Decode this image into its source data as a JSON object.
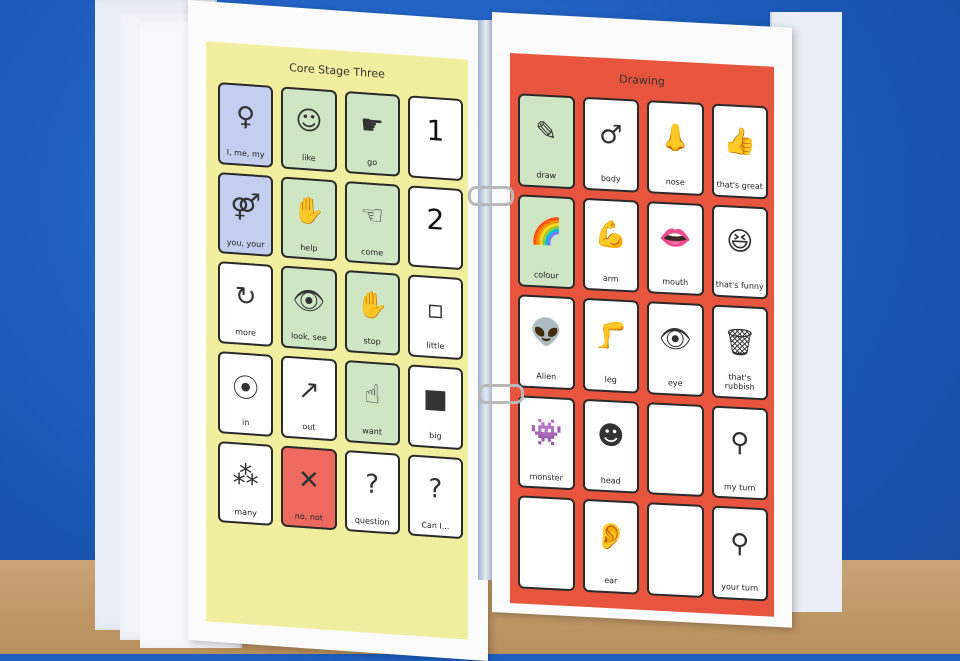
{
  "left_page": {
    "title": "Core Stage Three",
    "cards": [
      {
        "label": "I, me, my",
        "icon": "person-icon",
        "glyph": "♀",
        "bg": "blue"
      },
      {
        "label": "like",
        "icon": "smiley-face-icon",
        "glyph": "☺",
        "bg": "green"
      },
      {
        "label": "go",
        "icon": "pointing-hand-icon",
        "glyph": "☛",
        "bg": "green"
      },
      {
        "label": "",
        "icon": "number-one-icon",
        "glyph": "1",
        "bg": "white"
      },
      {
        "label": "you, your",
        "icon": "two-people-icon",
        "glyph": "⚤",
        "bg": "blue"
      },
      {
        "label": "help",
        "icon": "helping-hands-icon",
        "glyph": "✋",
        "bg": "green"
      },
      {
        "label": "come",
        "icon": "beckoning-hand-icon",
        "glyph": "☜",
        "bg": "green"
      },
      {
        "label": "",
        "icon": "number-two-icon",
        "glyph": "2",
        "bg": "white"
      },
      {
        "label": "more",
        "icon": "more-arrows-icon",
        "glyph": "↻",
        "bg": "white"
      },
      {
        "label": "look, see",
        "icon": "eyes-icon",
        "glyph": "👁",
        "bg": "green"
      },
      {
        "label": "stop",
        "icon": "stop-hand-icon",
        "glyph": "✋",
        "bg": "green"
      },
      {
        "label": "little",
        "icon": "little-square-icon",
        "glyph": "▫",
        "bg": "white"
      },
      {
        "label": "in",
        "icon": "in-box-icon",
        "glyph": "⦿",
        "bg": "white"
      },
      {
        "label": "out",
        "icon": "out-arrow-icon",
        "glyph": "↗",
        "bg": "white"
      },
      {
        "label": "want",
        "icon": "want-person-icon",
        "glyph": "☝",
        "bg": "green"
      },
      {
        "label": "big",
        "icon": "big-square-icon",
        "glyph": "■",
        "bg": "white"
      },
      {
        "label": "many",
        "icon": "many-circles-icon",
        "glyph": "⁂",
        "bg": "white"
      },
      {
        "label": "no, not",
        "icon": "cross-icon",
        "glyph": "✕",
        "bg": "red"
      },
      {
        "label": "question",
        "icon": "question-mark-icon",
        "glyph": "?",
        "bg": "white"
      },
      {
        "label": "Can I...",
        "icon": "question-person-icon",
        "glyph": "?",
        "bg": "white"
      }
    ]
  },
  "right_page": {
    "title": "Drawing",
    "cards": [
      {
        "label": "draw",
        "icon": "pencil-icon",
        "glyph": "✎",
        "bg": "green"
      },
      {
        "label": "body",
        "icon": "body-icon",
        "glyph": "♂",
        "bg": "white"
      },
      {
        "label": "nose",
        "icon": "nose-icon",
        "glyph": "👃",
        "bg": "white"
      },
      {
        "label": "that's great",
        "icon": "thumbs-up-icon",
        "glyph": "👍",
        "bg": "white"
      },
      {
        "label": "colour",
        "icon": "rainbow-icon",
        "glyph": "🌈",
        "bg": "green"
      },
      {
        "label": "arm",
        "icon": "arm-icon",
        "glyph": "💪",
        "bg": "white"
      },
      {
        "label": "mouth",
        "icon": "lips-icon",
        "glyph": "👄",
        "bg": "white"
      },
      {
        "label": "that's funny",
        "icon": "laughing-face-icon",
        "glyph": "😆",
        "bg": "white"
      },
      {
        "label": "Alien",
        "icon": "alien-icon",
        "glyph": "👽",
        "bg": "white"
      },
      {
        "label": "leg",
        "icon": "leg-icon",
        "glyph": "🦵",
        "bg": "white"
      },
      {
        "label": "eye",
        "icon": "eye-icon",
        "glyph": "👁",
        "bg": "white"
      },
      {
        "label": "that's rubbish",
        "icon": "trash-can-icon",
        "glyph": "🗑",
        "bg": "white"
      },
      {
        "label": "monster",
        "icon": "monster-icon",
        "glyph": "👾",
        "bg": "white"
      },
      {
        "label": "head",
        "icon": "head-icon",
        "glyph": "☻",
        "bg": "white"
      },
      {
        "label": "",
        "icon": "blank-card-icon",
        "glyph": "",
        "bg": "white"
      },
      {
        "label": "my turn",
        "icon": "my-turn-icon",
        "glyph": "⚲",
        "bg": "white"
      },
      {
        "label": "",
        "icon": "blank-card-icon",
        "glyph": "",
        "bg": "white"
      },
      {
        "label": "ear",
        "icon": "ear-icon",
        "glyph": "👂",
        "bg": "white"
      },
      {
        "label": "",
        "icon": "blank-card-icon",
        "glyph": "",
        "bg": "white"
      },
      {
        "label": "your turn",
        "icon": "your-turn-icon",
        "glyph": "⚲",
        "bg": "white"
      }
    ]
  }
}
